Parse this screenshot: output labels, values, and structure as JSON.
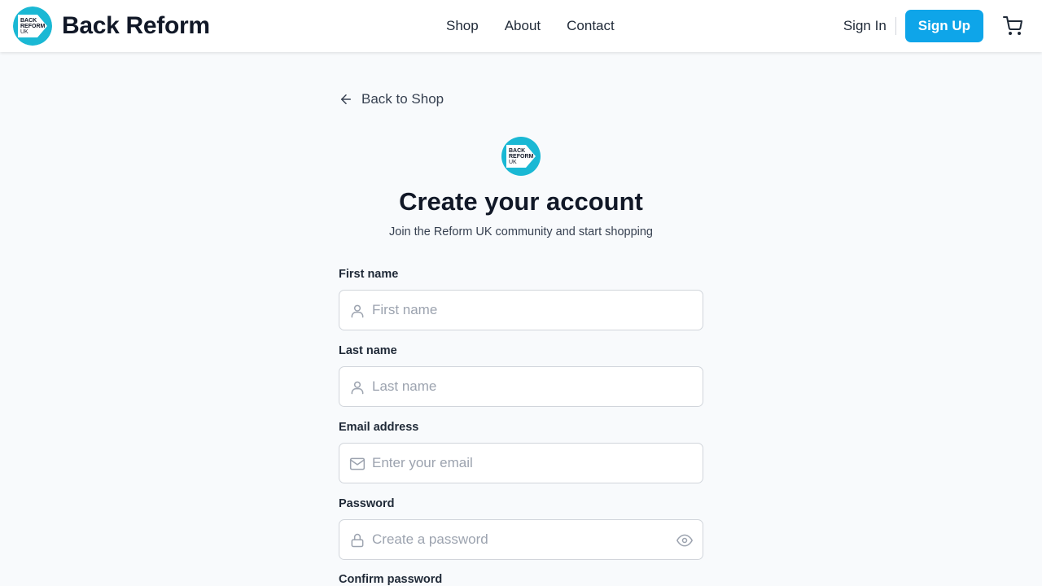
{
  "header": {
    "brand_name": "Back Reform",
    "logo_text": [
      "BACK",
      "REFORM",
      "UK"
    ],
    "nav": [
      "Shop",
      "About",
      "Contact"
    ],
    "sign_in": "Sign In",
    "sign_up": "Sign Up"
  },
  "colors": {
    "accent": "#0ea5e9",
    "logo_teal": "#1ab8d4"
  },
  "icons": {
    "cart": "shopping-cart-icon",
    "back": "arrow-left-icon",
    "user": "user-icon",
    "mail": "mail-icon",
    "lock": "lock-icon",
    "eye": "eye-icon"
  },
  "main": {
    "back_link": "Back to Shop",
    "title": "Create your account",
    "subtitle": "Join the Reform UK community and start shopping"
  },
  "form": {
    "first_name": {
      "label": "First name",
      "placeholder": "First name",
      "value": ""
    },
    "last_name": {
      "label": "Last name",
      "placeholder": "Last name",
      "value": ""
    },
    "email": {
      "label": "Email address",
      "placeholder": "Enter your email",
      "value": ""
    },
    "password": {
      "label": "Password",
      "placeholder": "Create a password",
      "value": ""
    },
    "confirm_password": {
      "label": "Confirm password"
    }
  }
}
